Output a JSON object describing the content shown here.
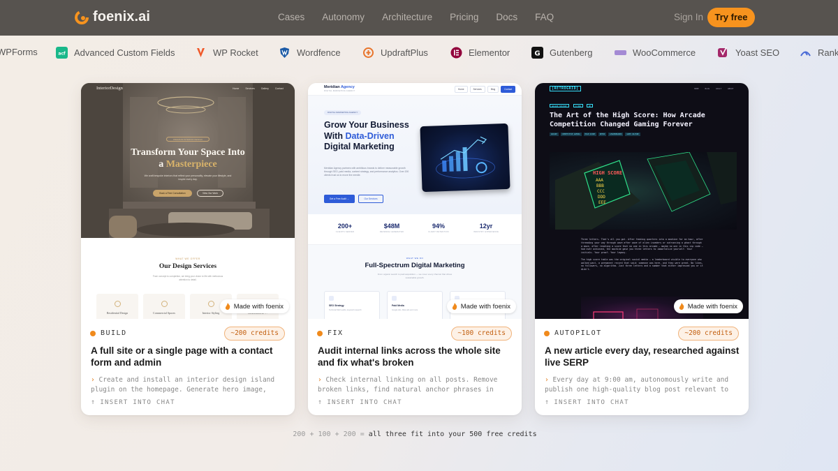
{
  "nav": {
    "brand": "foenix.ai",
    "links": [
      "Cases",
      "Autonomy",
      "Architecture",
      "Pricing",
      "Docs",
      "FAQ"
    ],
    "signin": "Sign In",
    "cta": "Try free"
  },
  "plugins": [
    {
      "label": "WPForms",
      "icon": "wpforms-icon"
    },
    {
      "label": "Advanced Custom Fields",
      "icon": "acf-icon"
    },
    {
      "label": "WP Rocket",
      "icon": "wp-rocket-icon"
    },
    {
      "label": "Wordfence",
      "icon": "wordfence-icon"
    },
    {
      "label": "UpdraftPlus",
      "icon": "updraftplus-icon"
    },
    {
      "label": "Elementor",
      "icon": "elementor-icon"
    },
    {
      "label": "Gutenberg",
      "icon": "gutenberg-icon"
    },
    {
      "label": "WooCommerce",
      "icon": "woocommerce-icon"
    },
    {
      "label": "Yoast SEO",
      "icon": "yoast-icon"
    },
    {
      "label": "Rank",
      "icon": "rank-math-icon"
    }
  ],
  "cards": [
    {
      "badge": "Made with foenix",
      "tag": "BUILD",
      "credits": "~200 credits",
      "title": "A full site or a single page with a contact form and admin",
      "desc": "Create and install an interior design island plugin on the homepage. Generate hero image, find…",
      "insert": "INSERT INTO CHAT",
      "preview": {
        "logo": "InteriorDesign",
        "links": [
          "Home",
          "Services",
          "Gallery",
          "Contact"
        ],
        "pill": "PREMIUM INTERIOR DESIGN",
        "h1_a": "Transform Your Space Into",
        "h1_b": "a ",
        "h1_accent": "Masterpiece",
        "sub": "We craft bespoke interiors that reflect your personality, elevate your lifestyle, and inspire every day.",
        "btn1": "Book a Free Consultation",
        "btn2": "View Our Work",
        "kicker": "WHAT WE OFFER",
        "h2": "Our Design Services",
        "p": "From concept to completion, we bring your vision to life with meticulous attention to detail.",
        "services": [
          "Residential Design",
          "Commercial Spaces",
          "Interior Styling",
          "Renovation & …"
        ]
      }
    },
    {
      "badge": "Made with foenix",
      "tag": "FIX",
      "credits": "~100 credits",
      "title": "Audit internal links across the whole site and fix what's broken",
      "desc": "Check internal linking on all posts. Remove broken links, find natural anchor phrases in the…",
      "insert": "INSERT INTO CHAT",
      "preview": {
        "logo_a": "Meridian ",
        "logo_b": "Agency",
        "logo_sub": "DIGITAL MARKETING AGENCY",
        "nav": [
          "Home",
          "Services",
          "Blog",
          "Contact"
        ],
        "pill": "DIGITAL MARKETING AGENCY",
        "h1_a": "Grow Your Business With",
        "h1_accent": "Data-Driven",
        "h1_b": " Digital Marketing",
        "p": "Meridian Agency partners with ambitious brands to deliver measurable growth through SEO, paid media, content strategy, and performance analytics. Over 200 clients trust us to move the needle.",
        "btn1": "Get a Free Audit →",
        "btn2": "Our Services",
        "stats": [
          {
            "value": "200+",
            "label": "CLIENTS SERVED"
          },
          {
            "value": "$48M",
            "label": "REVENUE GENERATED"
          },
          {
            "value": "94%",
            "label": "CLIENT RETENTION"
          },
          {
            "value": "12yr",
            "label": "INDUSTRY EXPERIENCE"
          }
        ],
        "kicker": "WHAT WE DO",
        "h2": "Full-Spectrum Digital Marketing",
        "sp": "From organic search to paid acquisition — we cover every channel that drives sustainable growth.",
        "boxes": [
          {
            "t": "SEO Strategy",
            "d": "Technical SEO audits, keyword research"
          },
          {
            "t": "Paid Media",
            "d": "Google Ads, Meta ads and more"
          },
          {
            "t": "",
            "d": ""
          }
        ]
      }
    },
    {
      "badge": "Made with foenix",
      "tag": "AUTOPILOT",
      "credits": "~200 credits",
      "title": "A new article every day, researched against live SERP",
      "desc": "Every day at 9:00 am, autonomously write and publish one high-quality blog post relevant to my…",
      "insert": "INSERT INTO CHAT",
      "preview": {
        "logo": "[RETROGRID]",
        "links": [
          "HOME",
          "BLOG",
          "VAULT",
          "ABOUT"
        ],
        "chips": [
          "ARCADE HISTORY",
          "8 MIN",
          "RP"
        ],
        "h1": "The Art of the High Score: How Arcade Competition Changed Gaming Forever",
        "tags": [
          "ARCADE",
          "COMPETITIVE GAMING",
          "HIGH SCORE",
          "RETRO",
          "LEADERBOARDS",
          "GAME CULTURE"
        ],
        "screen_text": [
          "HIGH SCORE",
          "AAA",
          "BBB",
          "CCC",
          "DDD",
          "EEE"
        ],
        "para1": "Three letters. That's all you got. After feeding quarters into a machine for an hour, after threading your way through wave after wave of alien invaders or outrunning a ghost through a maze, after reaching a score that no one in this arcade — maybe no one in this zip code — had ever achieved, the machine gave you three letters to immortalize yourself. Your initials. Your proof. Your legacy.",
        "para2": "The high score table was the original social media — a leaderboard visible to everyone who walked past, a permanent record that said: someone was here, and they were great. No likes, no followers, no algorithm. Just three letters and a number that either impressed you or it didn't."
      }
    }
  ],
  "footer": {
    "sum": "200 + 100 + 200 = ",
    "emph": "all three fit into your 500 free credits"
  },
  "colors": {
    "nav_bg": "#57534f",
    "accent": "#f7931e",
    "credit_text": "#c25f10",
    "meridian_blue": "#2e5bd8",
    "retro_cyan": "#37e2ff"
  }
}
